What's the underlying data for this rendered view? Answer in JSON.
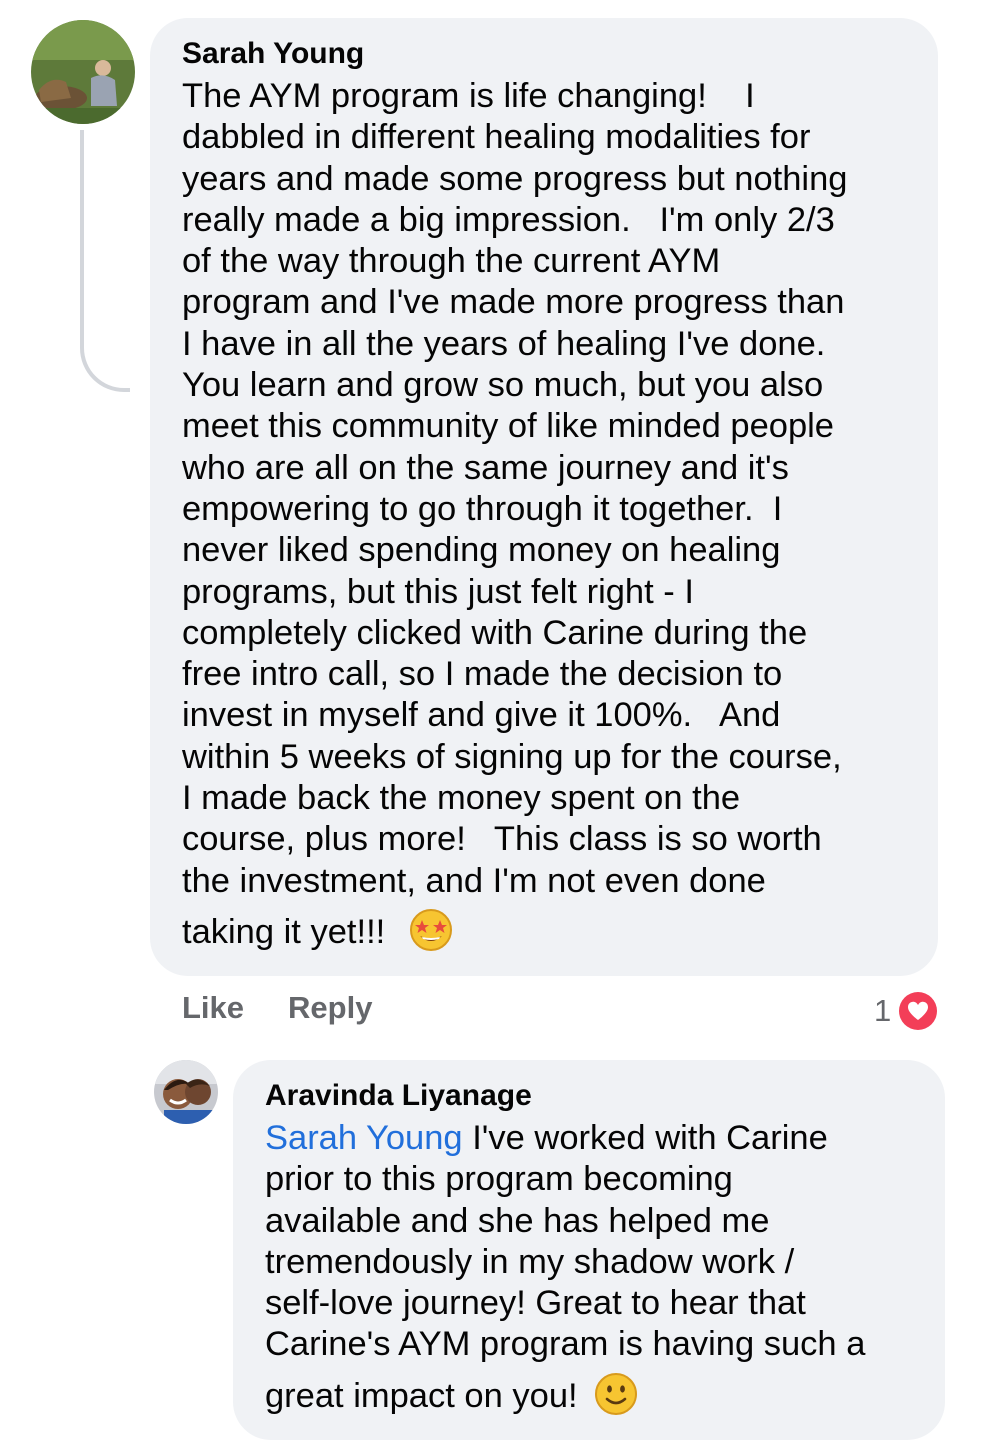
{
  "comment": {
    "author": "Sarah Young",
    "lines": [
      "The AYM program is life changing!    I",
      "dabbled in different healing modalities for",
      "years and made some progress but nothing",
      "really made a big impression.   I'm only 2/3",
      "of the way through the current AYM",
      "program and I've made more progress than",
      "I have in all the years of healing I've done.",
      "You learn and grow so much, but you also",
      "meet this community of like minded people",
      "who are all on the same journey and it's",
      "empowering to go through it together.  I",
      "never liked spending money on healing",
      "programs, but this just felt right - I",
      "completely clicked with Carine during the",
      "free intro call, so I made the decision to",
      "invest in myself and give it 100%.   And",
      "within 5 weeks of signing up for the course,",
      "I made back the money spent on the",
      "course, plus more!   This class is so worth",
      "the investment, and I'm not even done",
      "taking it yet!!!"
    ],
    "emoji": "star-struck-emoji",
    "like_label": "Like",
    "reply_label": "Reply",
    "reaction_count": "1",
    "reaction_type": "love-reaction-icon",
    "reaction_color": "#f33e58"
  },
  "reply": {
    "author": "Aravinda Liyanage",
    "mention": "Sarah Young",
    "first_line_rest": " I've worked with Carine",
    "lines": [
      "prior to this program becoming",
      "available and she has helped me",
      "tremendously in my shadow work /",
      "self-love journey! Great to hear that",
      "Carine's AYM program is having such a",
      "great impact on you!"
    ],
    "emoji": "slightly-smiling-face-emoji",
    "mention_color": "#216fdb"
  }
}
